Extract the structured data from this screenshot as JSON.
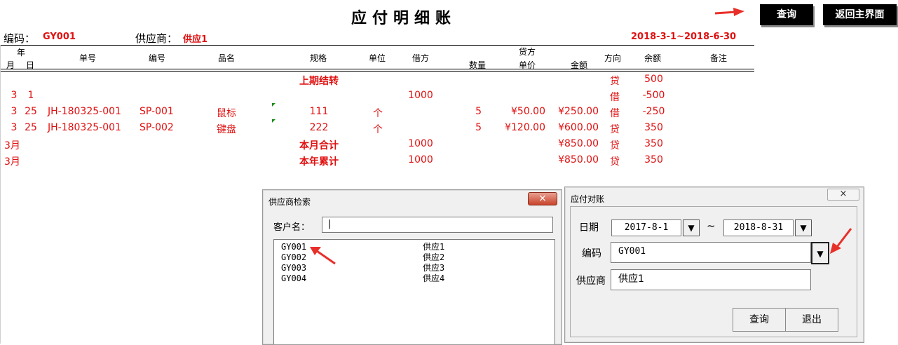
{
  "sheet": {
    "title": "应付明细账",
    "buttons": {
      "query": "查询",
      "home": "返回主界面"
    },
    "code_label": "编码：",
    "code_value": "GY001",
    "supplier_label": "供应商：",
    "supplier_value": "供应1",
    "date_range": "2018-3-1~2018-6-30",
    "headers": {
      "year": "年",
      "month": "月",
      "day": "日",
      "doc_no": "单号",
      "item_code": "编号",
      "item_name": "品名",
      "spec": "规格",
      "unit": "单位",
      "debit": "借方",
      "credit": "贷方",
      "qty": "数量",
      "price": "单价",
      "amount": "金额",
      "direction": "方向",
      "balance": "余额",
      "note": "备注"
    },
    "rows": [
      {
        "month": "",
        "day": "",
        "doc_no": "",
        "item_code": "",
        "item_name": "",
        "spec": "上期结转",
        "unit": "",
        "debit": "",
        "qty": "",
        "price": "",
        "amount": "",
        "direction": "贷",
        "balance": "500"
      },
      {
        "month": "3",
        "day": "1",
        "doc_no": "",
        "item_code": "",
        "item_name": "",
        "spec": "",
        "unit": "",
        "debit": "1000",
        "qty": "",
        "price": "",
        "amount": "",
        "direction": "借",
        "balance": "-500"
      },
      {
        "month": "3",
        "day": "25",
        "doc_no": "JH-180325-001",
        "item_code": "SP-001",
        "item_name": "鼠标",
        "spec": "111",
        "unit": "个",
        "debit": "",
        "qty": "5",
        "price": "¥50.00",
        "amount": "¥250.00",
        "direction": "借",
        "balance": "-250"
      },
      {
        "month": "3",
        "day": "25",
        "doc_no": "JH-180325-001",
        "item_code": "SP-002",
        "item_name": "键盘",
        "spec": "222",
        "unit": "个",
        "debit": "",
        "qty": "5",
        "price": "¥120.00",
        "amount": "¥600.00",
        "direction": "贷",
        "balance": "350"
      },
      {
        "month": "3月",
        "day": "",
        "doc_no": "",
        "item_code": "",
        "item_name": "",
        "spec": "本月合计",
        "unit": "",
        "debit": "1000",
        "qty": "",
        "price": "",
        "amount": "¥850.00",
        "direction": "贷",
        "balance": "350"
      },
      {
        "month": "3月",
        "day": "",
        "doc_no": "",
        "item_code": "",
        "item_name": "",
        "spec": "本年累计",
        "unit": "",
        "debit": "1000",
        "qty": "",
        "price": "",
        "amount": "¥850.00",
        "direction": "贷",
        "balance": "350"
      }
    ]
  },
  "supplier_search": {
    "title": "供应商检索",
    "close": "×",
    "name_label": "客户名：",
    "name_value": "|",
    "list": [
      {
        "code": "GY001",
        "name": "供应1"
      },
      {
        "code": "GY002",
        "name": "供应2"
      },
      {
        "code": "GY003",
        "name": "供应3"
      },
      {
        "code": "GY004",
        "name": "供应4"
      }
    ]
  },
  "reconcile": {
    "title": "应付对账",
    "close": "×",
    "date_label": "日期",
    "date_from": "2017-8-1",
    "date_to": "2018-8-31",
    "tilde": "~",
    "code_label": "编码",
    "code_value": "GY001",
    "supplier_label": "供应商",
    "supplier_value": "供应1",
    "dropdown_glyph": "▼",
    "query": "查询",
    "exit": "退出"
  },
  "colors": {
    "red_text": "#e01010",
    "annotation_arrow": "#e8302a",
    "button_bg": "#000000"
  },
  "icons": [
    "arrow-annotation-icon",
    "dropdown-arrow-icon",
    "close-icon"
  ]
}
